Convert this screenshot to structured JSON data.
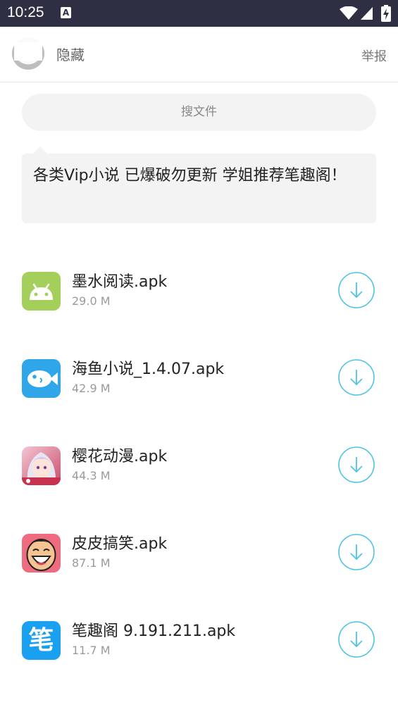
{
  "status_bar": {
    "time": "10:25",
    "notification_icon": "A"
  },
  "header": {
    "hide_label": "隐藏",
    "report_label": "举报"
  },
  "search": {
    "placeholder": "搜文件"
  },
  "message": {
    "text": "各类Vip小说 已爆破勿更新 学姐推荐笔趣阁！"
  },
  "files": [
    {
      "name": "墨水阅读.apk",
      "size": "29.0 M",
      "icon": "android-app-icon"
    },
    {
      "name": "海鱼小说_1.4.07.apk",
      "size": "42.9 M",
      "icon": "fish-app-icon"
    },
    {
      "name": "樱花动漫.apk",
      "size": "44.3 M",
      "icon": "anime-girl-app-icon"
    },
    {
      "name": "皮皮搞笑.apk",
      "size": "87.1 M",
      "icon": "laughing-face-app-icon"
    },
    {
      "name": "笔趣阁 9.191.211.apk",
      "size": "11.7 M",
      "icon": "pen-character-app-icon",
      "icon_text": "笔"
    }
  ],
  "colors": {
    "status_bar": "#2f2f43",
    "download_accent": "#4fc3e8"
  }
}
